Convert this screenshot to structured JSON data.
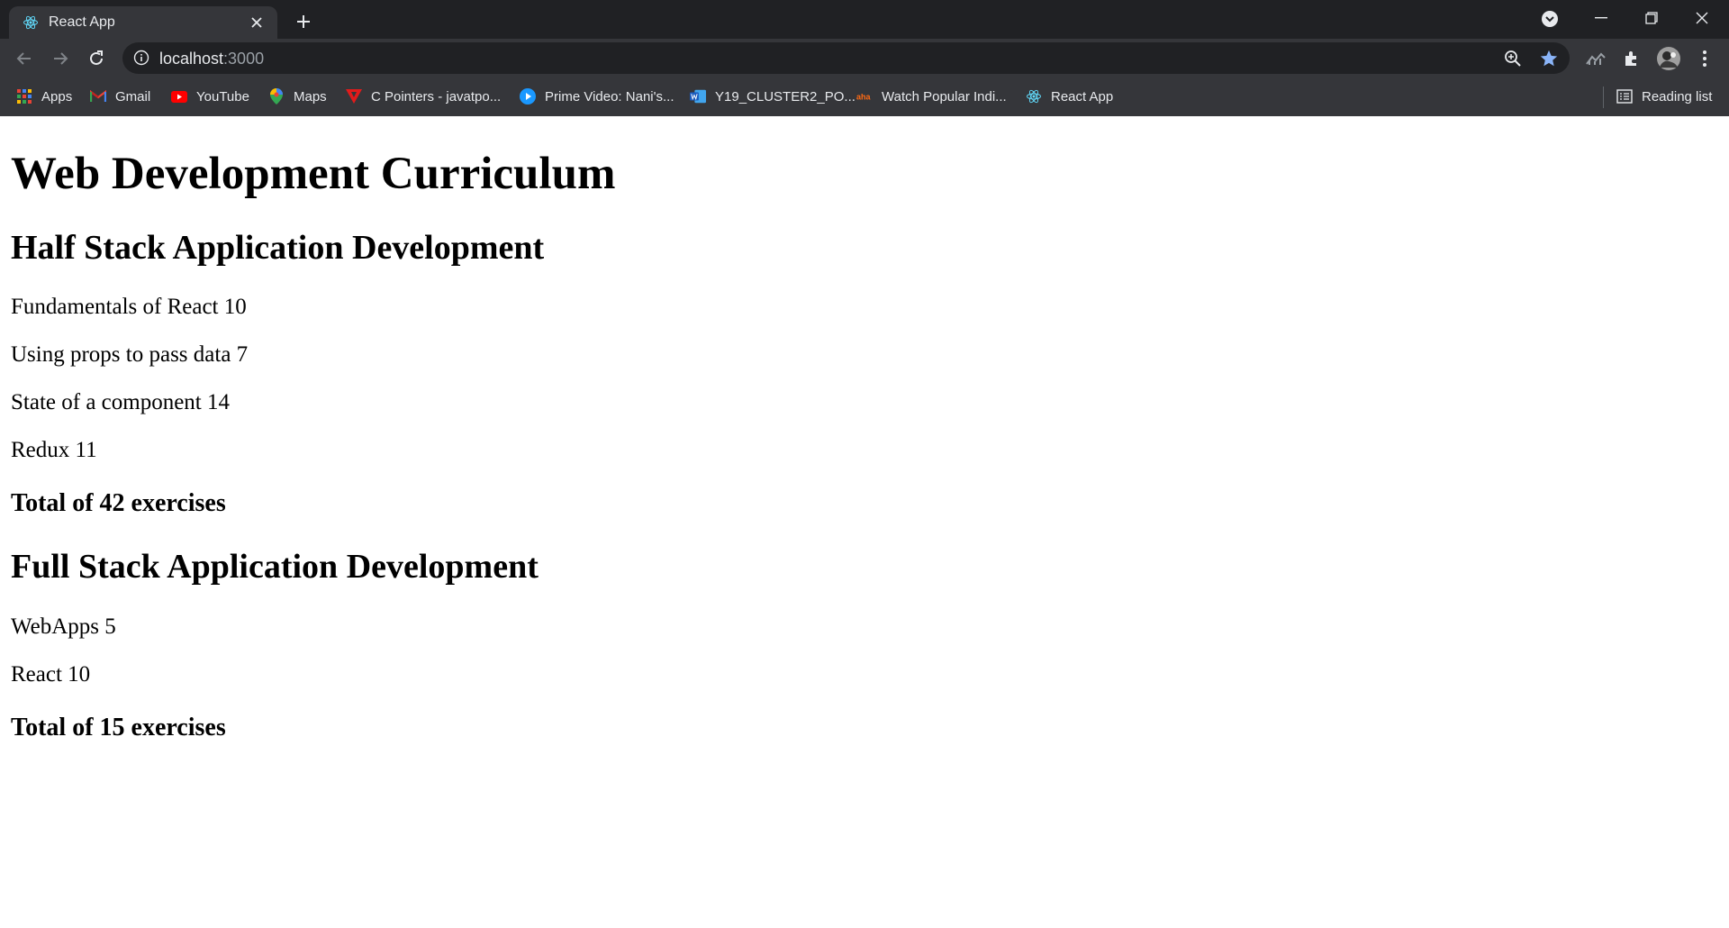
{
  "browser": {
    "tab_title": "React App",
    "url_host": "localhost",
    "url_port": ":3000",
    "bookmarks": [
      {
        "label": "Apps",
        "icon": "apps-grid-icon"
      },
      {
        "label": "Gmail",
        "icon": "gmail-icon"
      },
      {
        "label": "YouTube",
        "icon": "youtube-icon"
      },
      {
        "label": "Maps",
        "icon": "maps-icon"
      },
      {
        "label": "C Pointers - javatpo...",
        "icon": "javatpoint-icon"
      },
      {
        "label": "Prime Video: Nani's...",
        "icon": "prime-video-icon"
      },
      {
        "label": "Y19_CLUSTER2_PO...",
        "icon": "word-icon"
      },
      {
        "label": "Watch Popular Indi...",
        "icon": "aha-icon"
      },
      {
        "label": "React App",
        "icon": "react-icon"
      }
    ],
    "reading_list": "Reading list",
    "colors": {
      "accent_star": "#8ab4f8"
    }
  },
  "page": {
    "title": "Web Development Curriculum",
    "courses": [
      {
        "name": "Half Stack Application Development",
        "parts": [
          "Fundamentals of React 10",
          "Using props to pass data 7",
          "State of a component 14",
          "Redux 11"
        ],
        "total": "Total of 42 exercises"
      },
      {
        "name": "Full Stack Application Development",
        "parts": [
          "WebApps 5",
          "React 10"
        ],
        "total": "Total of 15 exercises"
      }
    ]
  }
}
